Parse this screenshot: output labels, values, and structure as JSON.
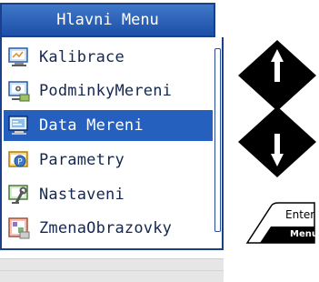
{
  "menu": {
    "title": "Hlavni Menu",
    "selected_index": 2,
    "items": [
      {
        "label": "Kalibrace",
        "icon": "monitor-icon"
      },
      {
        "label": "PodminkyMereni",
        "icon": "monitor-gear-icon"
      },
      {
        "label": "Data Mereni",
        "icon": "data-monitor-icon"
      },
      {
        "label": "Parametry",
        "icon": "parameters-icon"
      },
      {
        "label": "Nastaveni",
        "icon": "settings-tools-icon"
      },
      {
        "label": "ZmenaObrazovky",
        "icon": "screen-change-icon"
      }
    ]
  },
  "buttons": {
    "up": {
      "icon": "arrow-up-icon"
    },
    "down": {
      "icon": "arrow-down-icon"
    },
    "enter": {
      "line1": "Enter",
      "line2": "Menu"
    }
  },
  "colors": {
    "title_bar": "#2a5fb8",
    "selected_row": "#2560bf",
    "border": "#1c3f8a",
    "text": "#14284f"
  }
}
